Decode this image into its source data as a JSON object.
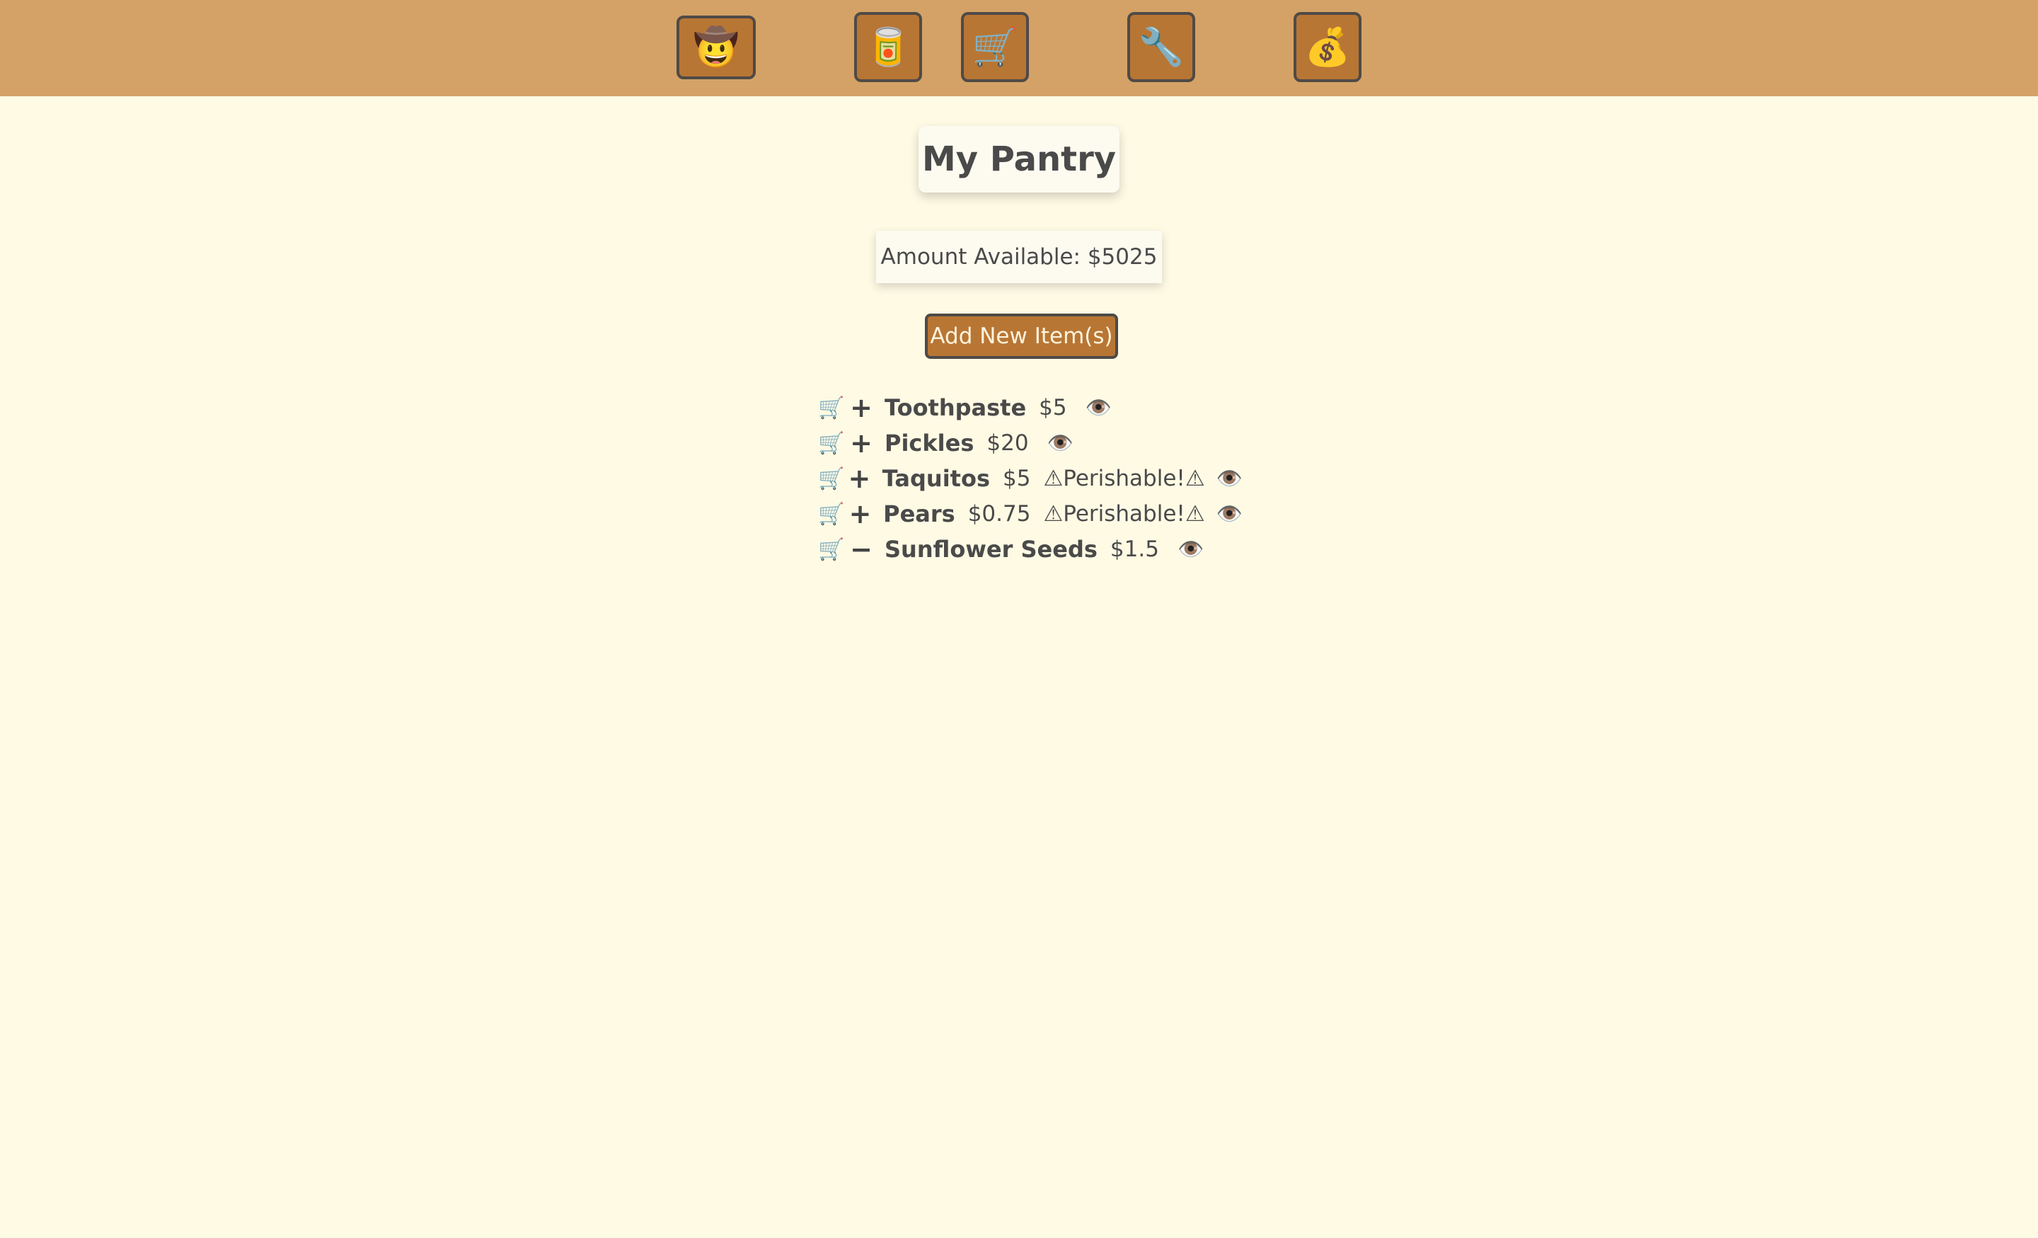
{
  "nav": {
    "buttons": [
      {
        "icon": "cowboy-hat-icon",
        "glyph": "🤠"
      },
      {
        "icon": "can-icon",
        "glyph": "🥫"
      },
      {
        "icon": "shopping-cart-icon",
        "glyph": "🛒"
      },
      {
        "icon": "wrench-icon",
        "glyph": "🔧"
      },
      {
        "icon": "money-bag-icon",
        "glyph": "💰"
      }
    ]
  },
  "page": {
    "title": "My Pantry",
    "amount_available": "Amount Available: $5025",
    "add_button_label": "Add New Item(s)"
  },
  "icons": {
    "cart": "🛒",
    "eye": "👁️",
    "plus": "+",
    "minus": "−"
  },
  "items": [
    {
      "name": "Toothpaste",
      "price": "$5",
      "perishable": "",
      "toggle": "+"
    },
    {
      "name": "Pickles",
      "price": "$20",
      "perishable": "",
      "toggle": "+"
    },
    {
      "name": "Taquitos",
      "price": "$5",
      "perishable": "⚠Perishable!⚠",
      "toggle": "+"
    },
    {
      "name": "Pears",
      "price": "$0.75",
      "perishable": "⚠Perishable!⚠",
      "toggle": "+"
    },
    {
      "name": "Sunflower Seeds",
      "price": "$1.5",
      "perishable": "",
      "toggle": "−"
    }
  ],
  "colors": {
    "navbar": "#d4a266",
    "button": "#b87634",
    "background": "#fefae4",
    "text": "#4a4a4a"
  }
}
